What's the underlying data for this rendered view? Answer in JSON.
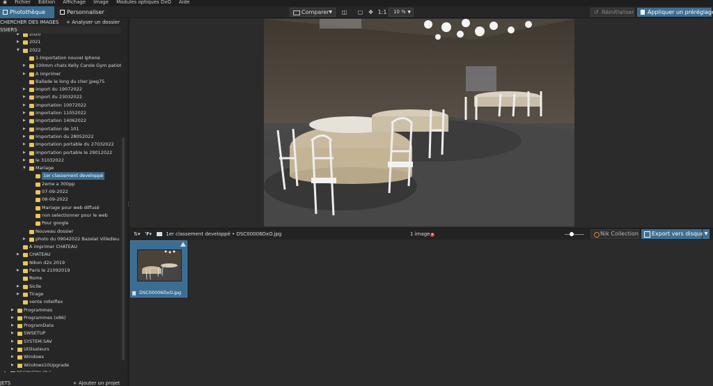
{
  "menu": [
    "Fichier",
    "Edition",
    "Affichage",
    "Image",
    "Modules optiques DxO",
    "Aide"
  ],
  "toolbar": {
    "tab_library": "Photothèque",
    "tab_customize": "Personnaliser",
    "compare_label": "Comparer",
    "ratio_label": "1:1",
    "zoom_value": "10 %",
    "reset_label": "Réinitialiser",
    "apply_preset_label": "Appliquer un préréglage"
  },
  "left_panel": {
    "search_title": "CHERCHER DES IMAGES",
    "analyze_folder": "+ Analyser un dossier",
    "folders_title": "SSIERS",
    "projects_title": "JETS",
    "add_project": "+ Ajouter un projet",
    "tree": [
      {
        "label": "2020",
        "level": 2,
        "arrow": "▶"
      },
      {
        "label": "2021",
        "level": 2,
        "arrow": "▶"
      },
      {
        "label": "2022",
        "level": 2,
        "arrow": "▼"
      },
      {
        "label": "1-Importation nouvel Iphone",
        "level": 3,
        "arrow": ""
      },
      {
        "label": "100mm chats Kelly Carole Gym patiot",
        "level": 3,
        "arrow": "▶"
      },
      {
        "label": "A imprimer",
        "level": 3,
        "arrow": "▶"
      },
      {
        "label": "Ballade le long du cher jpeg75",
        "level": 3,
        "arrow": ""
      },
      {
        "label": "import du 19072022",
        "level": 3,
        "arrow": "▶"
      },
      {
        "label": "import du 23032022",
        "level": 3,
        "arrow": "▶"
      },
      {
        "label": "importation 10072022",
        "level": 3,
        "arrow": "▶"
      },
      {
        "label": "importation 11052022",
        "level": 3,
        "arrow": "▶"
      },
      {
        "label": "importation 14062022",
        "level": 3,
        "arrow": "▶"
      },
      {
        "label": "importation de 101",
        "level": 3,
        "arrow": "▶"
      },
      {
        "label": "Importation du 28052022",
        "level": 3,
        "arrow": "▶"
      },
      {
        "label": "Importation portable du 27032022",
        "level": 3,
        "arrow": "▶"
      },
      {
        "label": "importation portable le 29012022",
        "level": 3,
        "arrow": "▶"
      },
      {
        "label": "le 31032022",
        "level": 3,
        "arrow": "▶"
      },
      {
        "label": "Mariage",
        "level": 3,
        "arrow": "▼"
      },
      {
        "label": "1er classement developpé",
        "level": 4,
        "arrow": "",
        "selected": true
      },
      {
        "label": "2eme a 300pp",
        "level": 4,
        "arrow": ""
      },
      {
        "label": "07-09-2022",
        "level": 4,
        "arrow": ""
      },
      {
        "label": "08-09-2022",
        "level": 4,
        "arrow": ""
      },
      {
        "label": "Mariage pour web diffusé",
        "level": 4,
        "arrow": ""
      },
      {
        "label": "non selectionner pour le web",
        "level": 4,
        "arrow": ""
      },
      {
        "label": "Pour google",
        "level": 4,
        "arrow": ""
      },
      {
        "label": "Nouveau dossier",
        "level": 3,
        "arrow": ""
      },
      {
        "label": "photo du 09042022 Bazelat Villedieu",
        "level": 3,
        "arrow": "▶"
      },
      {
        "label": "A imprimer CHATEAU",
        "level": 2,
        "arrow": ""
      },
      {
        "label": "CHATEAU",
        "level": 2,
        "arrow": "▶"
      },
      {
        "label": "Nikon d2x 2019",
        "level": 2,
        "arrow": ""
      },
      {
        "label": "Paris le 21092019",
        "level": 2,
        "arrow": "▶"
      },
      {
        "label": "Rome",
        "level": 2,
        "arrow": ""
      },
      {
        "label": "Sicile",
        "level": 2,
        "arrow": "▶"
      },
      {
        "label": "Tirage",
        "level": 2,
        "arrow": "▶"
      },
      {
        "label": "vente rolleiflex",
        "level": 2,
        "arrow": ""
      },
      {
        "label": "Programmes",
        "level": 1,
        "arrow": "▶"
      },
      {
        "label": "Programmes (x86)",
        "level": 1,
        "arrow": "▶"
      },
      {
        "label": "ProgramData",
        "level": 1,
        "arrow": "▶"
      },
      {
        "label": "SWSETUP",
        "level": 1,
        "arrow": "▶"
      },
      {
        "label": "SYSTEM.SAV",
        "level": 1,
        "arrow": "▶"
      },
      {
        "label": "Utilisateurs",
        "level": 1,
        "arrow": "▶"
      },
      {
        "label": "Windows",
        "level": 1,
        "arrow": "▶"
      },
      {
        "label": "Windows10Upgrade",
        "level": 1,
        "arrow": "▶"
      },
      {
        "label": "RECOVERY (D:)",
        "level": 0,
        "arrow": "▶",
        "drive": true
      }
    ]
  },
  "filmstrip_bar": {
    "breadcrumb_folder": "1er classement developpé",
    "breadcrumb_sep": "•",
    "breadcrumb_file": "DSC00006DxO.jpg",
    "count_label": "1 image",
    "nik_label": "Nik Collection",
    "export_label": "Export vers disque"
  },
  "thumbnails": [
    {
      "filename": "DSC00006DxO.jpg"
    }
  ],
  "colors": {
    "accent": "#3a6d92",
    "folder": "#e8c65a",
    "panel_bg": "#262626"
  }
}
